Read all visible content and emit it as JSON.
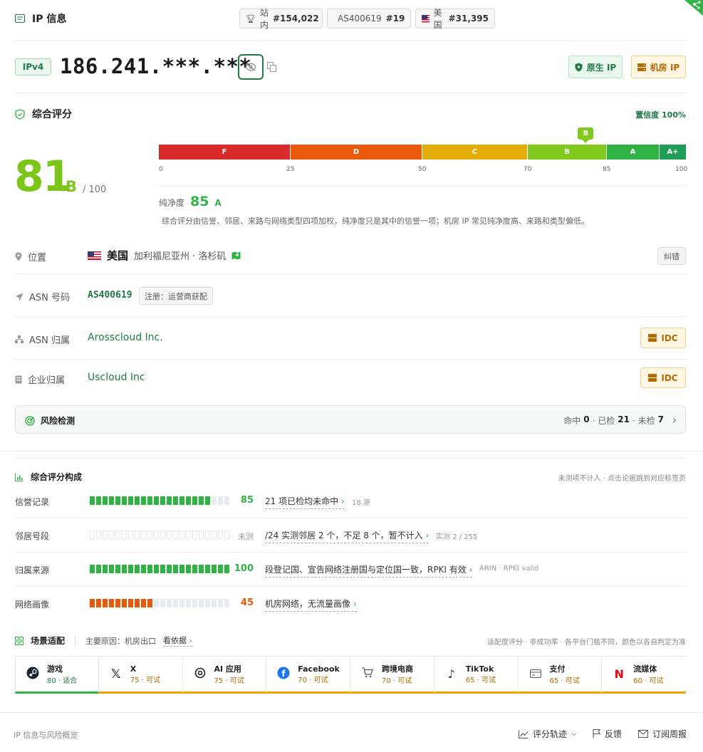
{
  "header": {
    "title": "IP 信息",
    "pills": [
      {
        "label": "站内",
        "value": "#154,022"
      },
      {
        "label": "AS400619",
        "value": "#19"
      },
      {
        "label": "美国",
        "value": "#31,395"
      }
    ]
  },
  "ip": {
    "version": "IPv4",
    "address": "186.241.***.***",
    "native_label": "原生 IP",
    "datacenter_label": "机房 IP"
  },
  "score": {
    "section_title": "综合评分",
    "confidence": "置信度 100%",
    "value": "81",
    "grade": "B",
    "out_of": "/ 100",
    "marker_grade": "B",
    "marker_value": 81,
    "segments": [
      {
        "label": "F",
        "from": 0,
        "to": 25,
        "color": "#d92b2b"
      },
      {
        "label": "D",
        "from": 25,
        "to": 50,
        "color": "#e8590c"
      },
      {
        "label": "C",
        "from": 50,
        "to": 70,
        "color": "#e3ad08"
      },
      {
        "label": "B",
        "from": 70,
        "to": 85,
        "color": "#82c91e"
      },
      {
        "label": "A",
        "from": 85,
        "to": 95,
        "color": "#2fb344"
      },
      {
        "label": "A+",
        "from": 95,
        "to": 100,
        "color": "#1f9d55"
      }
    ],
    "ticks": [
      "0",
      "25",
      "50",
      "70",
      "85",
      "100"
    ],
    "purity_label": "纯净度",
    "purity_value": "85",
    "purity_grade": "A",
    "note": "综合评分由信誉、邻居、来路与网络类型四项加权，纯净度只是其中的信誉一项；机房 IP 常见纯净度高、来路和类型偏低。"
  },
  "info": {
    "location_label": "位置",
    "country": "美国",
    "region": "加利福尼亚州 · 洛杉矶",
    "correct_button": "纠错",
    "asn_label": "ASN 号码",
    "asn": "AS400619",
    "asn_reg": "注册：运营商获配",
    "asn_owner_label": "ASN 归属",
    "asn_owner": "Arosscloud Inc.",
    "org_label": "企业归属",
    "org": "Uscloud Inc",
    "idc_label": "IDC"
  },
  "risk": {
    "title": "风险检测",
    "hit_label": "命中",
    "hit": "0",
    "checked_label": "· 已检",
    "checked": "21",
    "unchecked_label": "· 未检",
    "unchecked": "7"
  },
  "breakdown": {
    "title": "综合评分构成",
    "hint": "未测项不计入 · 点击论据跳到对应标签页",
    "rows": [
      {
        "label": "信誉记录",
        "score": "85",
        "fill": 0.85,
        "color": "#2fb344",
        "desc": "21 项已检均未命中",
        "sub": "18 源"
      },
      {
        "label": "邻居号段",
        "score": "未测",
        "fill": 0,
        "color": "#2fb344",
        "desc": "/24 实测邻居 2 个，不足 8 个，暂不计入",
        "sub": "实测 2 / 255"
      },
      {
        "label": "归属来源",
        "score": "100",
        "fill": 1.0,
        "color": "#2fb344",
        "desc": "段登记国、宣告网络注册国与定位国一致，RPKI 有效",
        "sub": "ARIN · RPKI valid"
      },
      {
        "label": "网络画像",
        "score": "45",
        "fill": 0.45,
        "color": "#e8590c",
        "desc": "机房网络，无流量画像",
        "sub": ""
      }
    ]
  },
  "scenes": {
    "title": "场景适配",
    "reason_label": "主要原因：机房出口",
    "basis_link": "看依据",
    "hint": "适配度评分 · 非成功率 · 各平台门槛不同，颜色以各自判定为准",
    "items": [
      {
        "name": "游戏",
        "value": "80 · 适合",
        "icon": "steam-icon",
        "good": true
      },
      {
        "name": "X",
        "value": "75 · 可试",
        "icon": "x-icon",
        "good": false
      },
      {
        "name": "AI 应用",
        "value": "75 · 可试",
        "icon": "openai-icon",
        "good": false
      },
      {
        "name": "Facebook",
        "value": "70 · 可试",
        "icon": "facebook-icon",
        "good": false
      },
      {
        "name": "跨境电商",
        "value": "70 · 可试",
        "icon": "cart-icon",
        "good": false
      },
      {
        "name": "TikTok",
        "value": "65 · 可试",
        "icon": "tiktok-icon",
        "good": false
      },
      {
        "name": "支付",
        "value": "65 · 可试",
        "icon": "card-icon",
        "good": false
      },
      {
        "name": "流媒体",
        "value": "60 · 可试",
        "icon": "netflix-icon",
        "good": false
      }
    ]
  },
  "footer": {
    "left": "IP 信息与风险概览",
    "track": "评分轨迹",
    "feedback": "反馈",
    "subscribe": "订阅周报"
  },
  "colors": {
    "accent": "#1f7a45",
    "grade_b": "#82c91e",
    "warn": "#f0a500"
  }
}
